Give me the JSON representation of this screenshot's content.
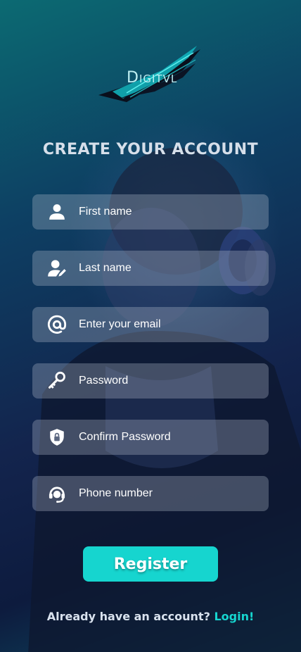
{
  "brand": {
    "logo_text": "Digitvl"
  },
  "header": {
    "title": "CREATE YOUR ACCOUNT"
  },
  "form": {
    "fields": [
      {
        "placeholder": "First name",
        "icon": "person-icon"
      },
      {
        "placeholder": "Last name",
        "icon": "person-edit-icon"
      },
      {
        "placeholder": "Enter your email",
        "icon": "at-sign-icon"
      },
      {
        "placeholder": "Password",
        "icon": "key-icon"
      },
      {
        "placeholder": "Confirm Password",
        "icon": "shield-lock-icon"
      },
      {
        "placeholder": "Phone number",
        "icon": "headset-icon"
      }
    ],
    "register_label": "Register"
  },
  "footer": {
    "prompt": "Already have an account?",
    "login_label": "Login!"
  },
  "colors": {
    "accent": "#16d5cf",
    "field_bg": "rgba(180,190,205,0.32)",
    "title": "#d6dfea"
  }
}
